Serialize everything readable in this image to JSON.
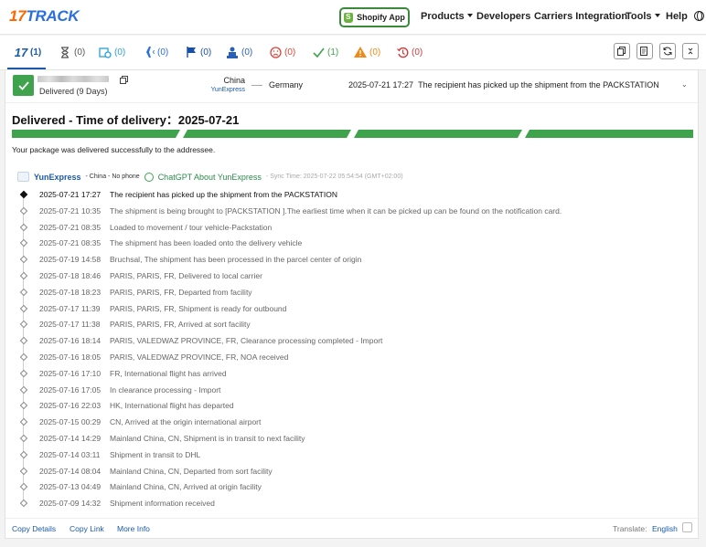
{
  "logo": {
    "part1": "17",
    "part2": "TRACK"
  },
  "nav": {
    "shopify": "Shopify App",
    "products": "Products",
    "developers": "Developers",
    "carriers": "Carriers Integration",
    "tools": "Tools",
    "help": "Help"
  },
  "tabs": [
    {
      "icon": "all-17-icon",
      "count": "(1)",
      "color": "#1a5aa8"
    },
    {
      "icon": "hourglass-icon",
      "count": "(0)",
      "color": "#555555"
    },
    {
      "icon": "package-clock-icon",
      "count": "(0)",
      "color": "#2a9fd8"
    },
    {
      "icon": "airplane-icon",
      "count": "(0)",
      "color": "#2a6fdb"
    },
    {
      "icon": "flag-icon",
      "count": "(0)",
      "color": "#1a4fa8"
    },
    {
      "icon": "courier-icon",
      "count": "(0)",
      "color": "#2a5fb8"
    },
    {
      "icon": "sad-face-icon",
      "count": "(0)",
      "color": "#e0453a"
    },
    {
      "icon": "check-icon",
      "count": "(1)",
      "color": "#3fa34d"
    },
    {
      "icon": "warning-icon",
      "count": "(0)",
      "color": "#f08a16"
    },
    {
      "icon": "history-icon",
      "count": "(0)",
      "color": "#d03a3a"
    }
  ],
  "summary": {
    "status": "Delivered (9 Days)",
    "origin_country": "China",
    "origin_carrier": "YunExpress",
    "destination": "Germany",
    "latest_time": "2025-07-21 17:27",
    "latest_desc": "The recipient has picked up the shipment from the PACKSTATION"
  },
  "headline": {
    "label": "Delivered - Time of delivery：",
    "date": "2025-07-21"
  },
  "progress_segments": 4,
  "delivered_msg": "Your package was delivered successfully to the addressee.",
  "carrier": {
    "name": "YunExpress",
    "meta": "- China - No phone",
    "gpt_link": "ChatGPT About YunExpress",
    "sync": "- Sync Time: 2025-07-22 05:54:54 (GMT+02:00)"
  },
  "events": [
    {
      "time": "2025-07-21 17:27",
      "desc": "The recipient has picked up the shipment from the PACKSTATION"
    },
    {
      "time": "2025-07-21 10:35",
      "desc": "The shipment is being brought to [PACKSTATION ].The earliest time when it can be picked up can be found on the notification card."
    },
    {
      "time": "2025-07-21 08:35",
      "desc": "Loaded to movement / tour vehicle-Packstation"
    },
    {
      "time": "2025-07-21 08:35",
      "desc": "The shipment has been loaded onto the delivery vehicle"
    },
    {
      "time": "2025-07-19 14:58",
      "desc": "Bruchsal, The shipment has been processed in the parcel center of origin"
    },
    {
      "time": "2025-07-18 18:46",
      "desc": "PARIS, PARIS, FR, Delivered to local carrier"
    },
    {
      "time": "2025-07-18 18:23",
      "desc": "PARIS, PARIS, FR, Departed from facility"
    },
    {
      "time": "2025-07-17 11:39",
      "desc": "PARIS, PARIS, FR, Shipment is ready for outbound"
    },
    {
      "time": "2025-07-17 11:38",
      "desc": "PARIS, PARIS, FR, Arrived at sort facility"
    },
    {
      "time": "2025-07-16 18:14",
      "desc": "PARIS, VALEDWAZ PROVINCE, FR, Clearance processing completed - Import"
    },
    {
      "time": "2025-07-16 18:05",
      "desc": "PARIS, VALEDWAZ PROVINCE, FR, NOA received"
    },
    {
      "time": "2025-07-16 17:10",
      "desc": "FR, International flight has arrived"
    },
    {
      "time": "2025-07-16 17:05",
      "desc": "In clearance processing - Import"
    },
    {
      "time": "2025-07-16 22:03",
      "desc": "HK, International flight has departed"
    },
    {
      "time": "2025-07-15 00:29",
      "desc": "CN, Arrived at the origin international airport"
    },
    {
      "time": "2025-07-14 14:29",
      "desc": "Mainland China, CN, Shipment is in transit to next facility"
    },
    {
      "time": "2025-07-14 03:11",
      "desc": "Shipment in transit to DHL"
    },
    {
      "time": "2025-07-14 08:04",
      "desc": "Mainland China, CN, Departed from sort facility"
    },
    {
      "time": "2025-07-13 04:49",
      "desc": "Mainland China, CN, Arrived at origin facility"
    },
    {
      "time": "2025-07-09 14:32",
      "desc": "Shipment information received"
    }
  ],
  "footer": {
    "copy_details": "Copy Details",
    "copy_link": "Copy Link",
    "more_info": "More Info",
    "translate_label": "Translate:",
    "translate_lang": "English"
  },
  "colors": {
    "accent": "#1a5aa8",
    "success": "#3fa34d",
    "logo_orange": "#ff6600",
    "logo_blue": "#2a6fdb"
  }
}
